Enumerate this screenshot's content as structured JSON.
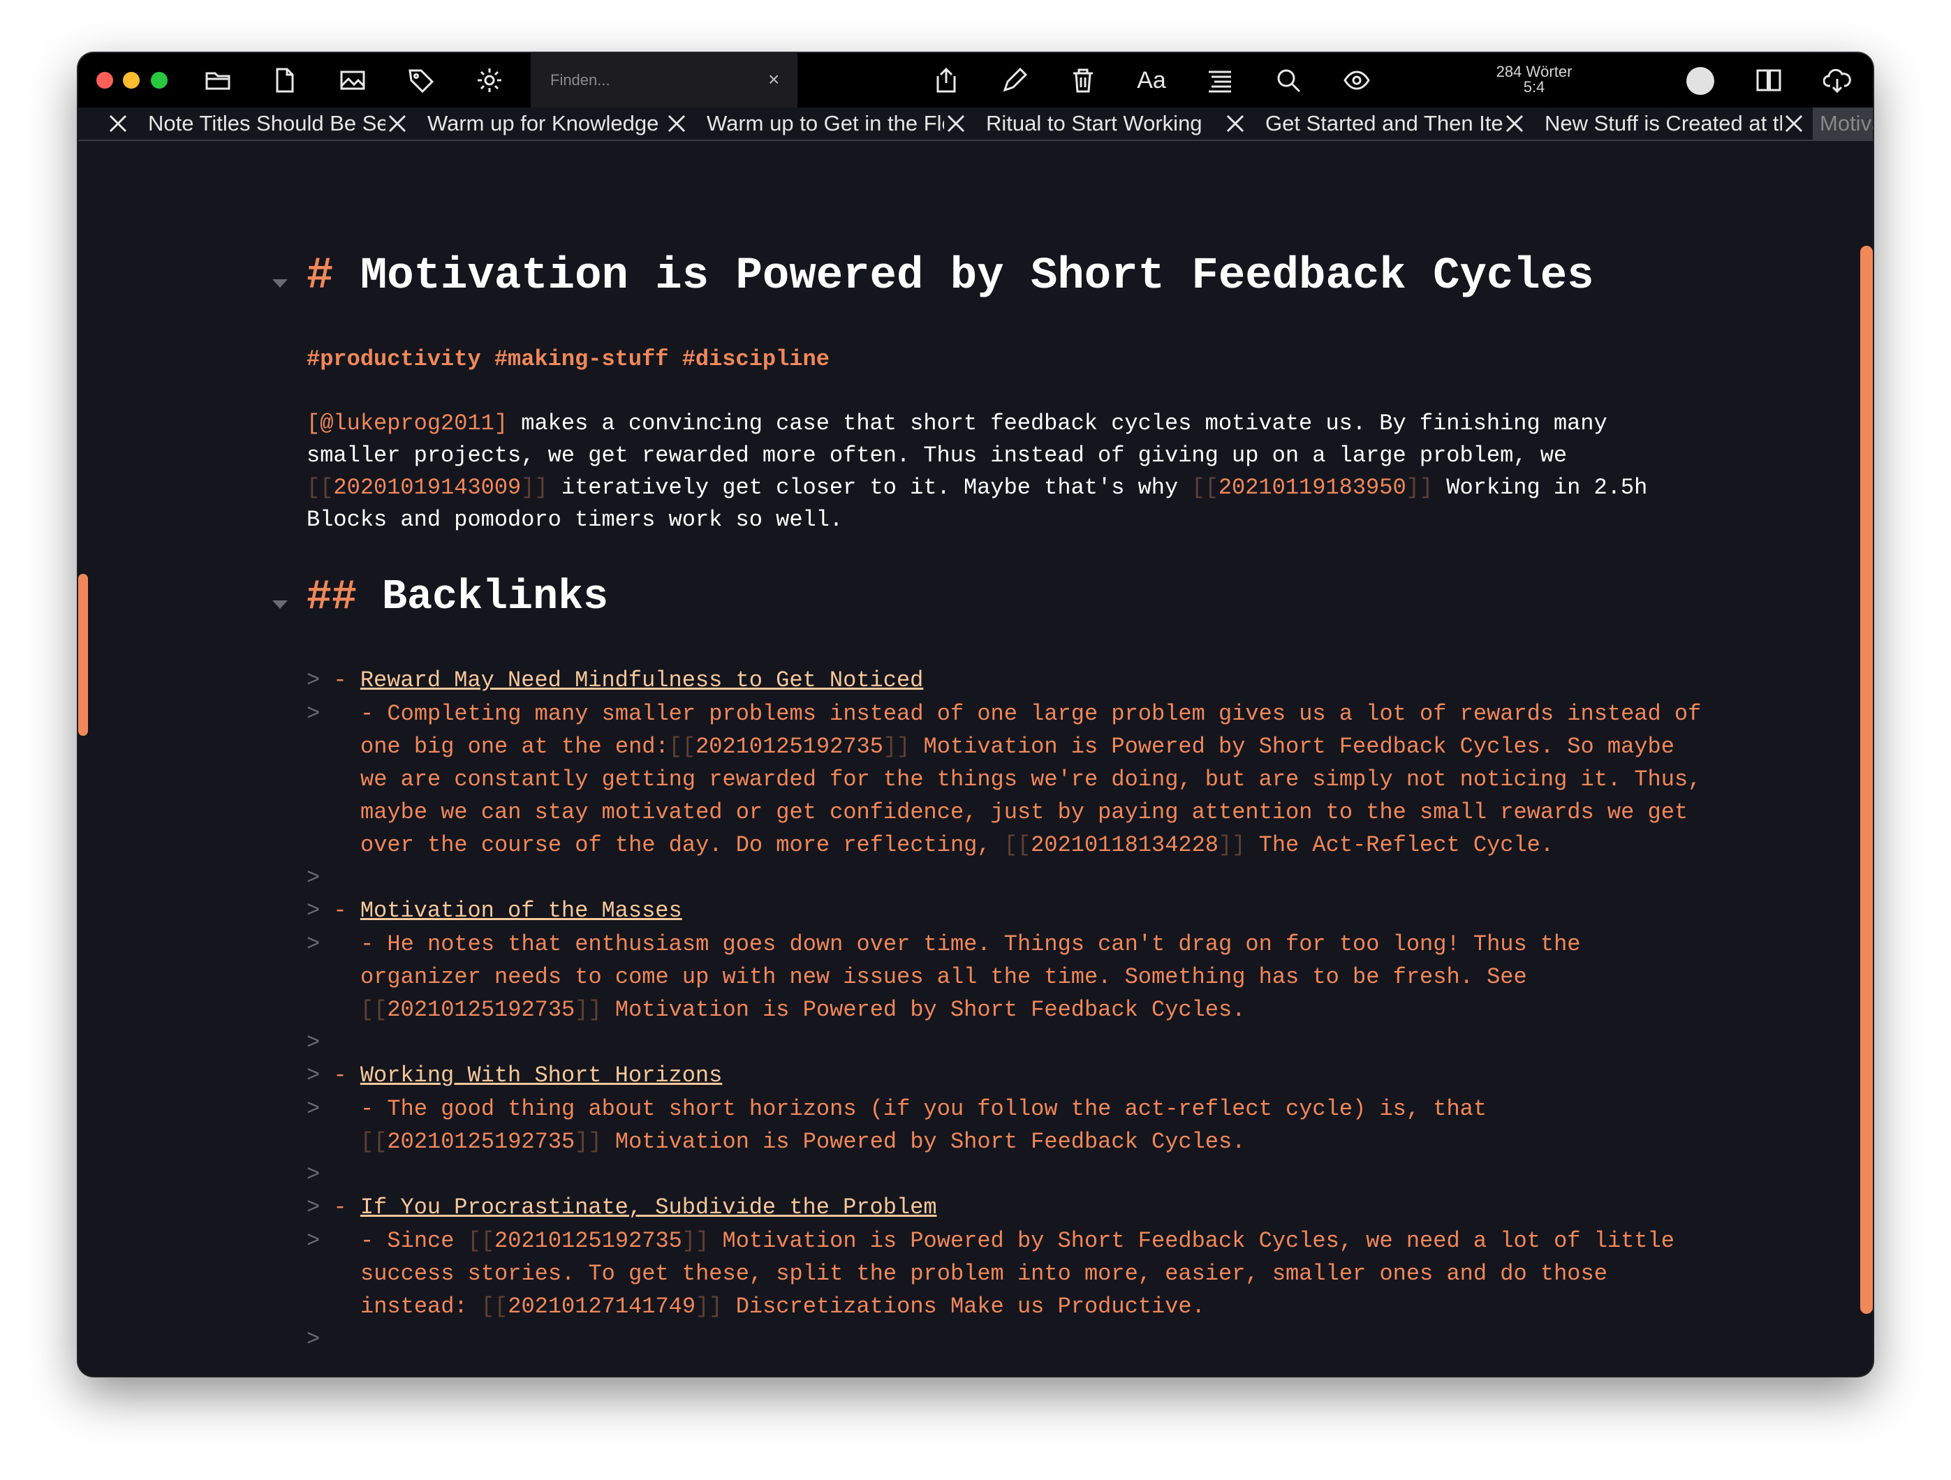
{
  "toolbar": {
    "icons": [
      "folder-icon",
      "new-file-icon",
      "image-icon",
      "tag-icon",
      "gear-icon"
    ],
    "search": {
      "placeholder": "Finden...",
      "clear": "×"
    },
    "right_icons": [
      "share-icon",
      "pencil-icon",
      "trash-icon",
      "font-icon",
      "outline-icon",
      "search-icon",
      "eye-icon"
    ],
    "font_label": "Aa",
    "stats_words": "284 Wörter",
    "stats_pos": "5:4"
  },
  "tabs": [
    {
      "label": "Note Titles Should Be Sentences"
    },
    {
      "label": "Warm up for Knowledge Work"
    },
    {
      "label": "Warm up to Get in the Flow"
    },
    {
      "label": "Ritual to Start Working"
    },
    {
      "label": "Get Started and Then Iterate"
    },
    {
      "label": "New Stuff is Created at the Edges"
    },
    {
      "label": "Motivation is Powered by Short Feedback Cycles"
    }
  ],
  "note": {
    "h1_mark": "#",
    "title": "Motivation is Powered by Short Feedback Cycles",
    "tags": "#productivity #making-stuff #discipline",
    "para": {
      "cite": "[@lukeprog2011]",
      "t1": " makes a convincing case that short feedback cycles motivate us. By finishing many",
      "t2": "smaller projects, we get rewarded more often. Thus instead of giving up on a large problem, we",
      "link1": "20201019143009",
      "t3": " iteratively get closer to it. Maybe that's why ",
      "link2": "20210119183950",
      "t4": " Working in 2.5h",
      "t5": "Blocks and pomodoro timers work so well."
    },
    "h2_mark": "##",
    "h2": "Backlinks",
    "quote_mark": ">",
    "dash": "-",
    "open_br": "[[",
    "close_br": "]]",
    "backlinks": [
      {
        "title": "Reward May Need Mindfulness to Get Noticed",
        "l1": "- Completing many smaller problems instead of one large problem gives us a lot of rewards instead of",
        "l2a": "one big one at the end:",
        "l2id": "20210125192735",
        "l2b": " Motivation is Powered by Short Feedback Cycles. So maybe",
        "l3": "we are constantly getting rewarded for the things we're doing, but are simply not noticing it. Thus,",
        "l4": "maybe we can stay motivated or get confidence, just by paying attention to the small rewards we get",
        "l5a": "over the course of the day. Do more reflecting, ",
        "l5id": "20210118134228",
        "l5b": " The Act-Reflect Cycle."
      },
      {
        "title": "Motivation of the Masses",
        "l1": "- He notes that enthusiasm goes down over time. Things can't drag on for too long! Thus the",
        "l2": "organizer needs to come up with new issues all the time. Something has to be fresh. See",
        "l3id": "20210125192735",
        "l3b": " Motivation is Powered by Short Feedback Cycles."
      },
      {
        "title": "Working With Short Horizons",
        "l1": "- The good thing about short horizons (if you follow the act-reflect cycle) is, that",
        "l2id": "20210125192735",
        "l2b": " Motivation is Powered by Short Feedback Cycles."
      },
      {
        "title": "If You Procrastinate, Subdivide the Problem",
        "l1a": "- Since ",
        "l1id": "20210125192735",
        "l1b": " Motivation is Powered by Short Feedback Cycles, we need a lot of little",
        "l2": "success stories. To get these, split the problem into more, easier, smaller ones and do those",
        "l3a": "instead: ",
        "l3id": "20210127141749",
        "l3b": " Discretizations Make us Productive."
      }
    ]
  },
  "colors": {
    "accent": "#f0885a",
    "background": "#15151e",
    "toolbar": "#000000",
    "link": "#f6c89a"
  }
}
